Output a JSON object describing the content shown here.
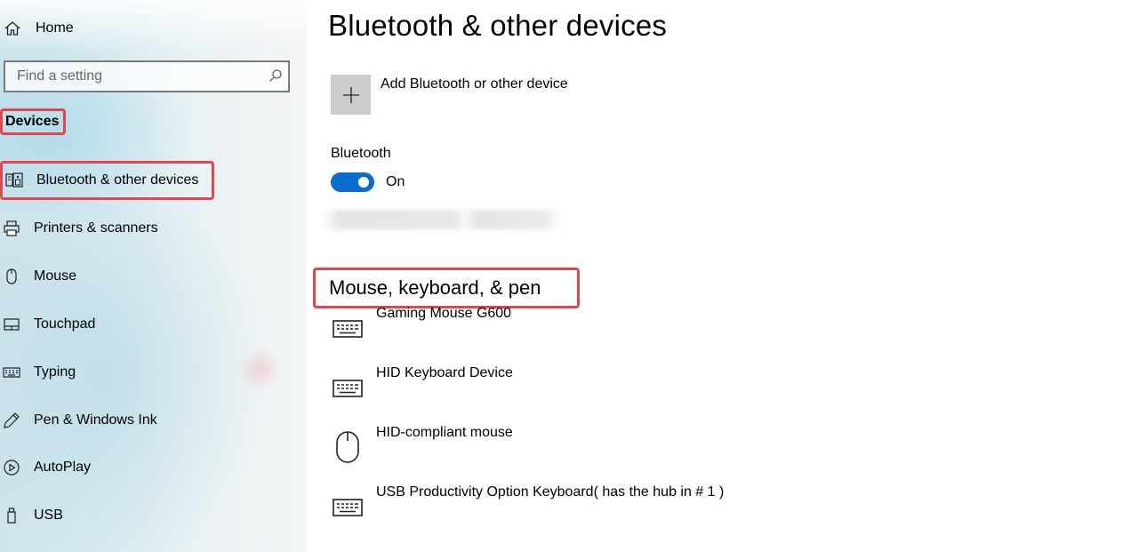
{
  "sidebar": {
    "home": {
      "label": "Home",
      "icon": "home-icon"
    },
    "search": {
      "placeholder": "Find a setting",
      "icon": "search-icon"
    },
    "section_label": "Devices",
    "items": [
      {
        "label": "Bluetooth & other devices",
        "icon": "bluetooth-devices-icon",
        "selected": true
      },
      {
        "label": "Printers & scanners",
        "icon": "printer-icon"
      },
      {
        "label": "Mouse",
        "icon": "mouse-icon"
      },
      {
        "label": "Touchpad",
        "icon": "touchpad-icon"
      },
      {
        "label": "Typing",
        "icon": "keyboard-icon"
      },
      {
        "label": "Pen & Windows Ink",
        "icon": "pen-icon"
      },
      {
        "label": "AutoPlay",
        "icon": "autoplay-icon"
      },
      {
        "label": "USB",
        "icon": "usb-icon"
      }
    ]
  },
  "main": {
    "title": "Bluetooth & other devices",
    "add_device": {
      "label": "Add Bluetooth or other device",
      "icon": "plus-icon"
    },
    "bluetooth": {
      "label": "Bluetooth",
      "state": "On",
      "enabled": true
    },
    "section_heading": "Mouse, keyboard, & pen",
    "devices": [
      {
        "name": "Gaming Mouse G600",
        "icon": "keyboard-icon"
      },
      {
        "name": "HID Keyboard Device",
        "icon": "keyboard-icon"
      },
      {
        "name": "HID-compliant mouse",
        "icon": "mouse-icon"
      },
      {
        "name": "USB Productivity Option Keyboard( has the hub in # 1 )",
        "icon": "keyboard-icon"
      }
    ]
  },
  "colors": {
    "accent": "#0a6ccf",
    "highlight_border": "#e0464f",
    "add_tile": "#cccccc"
  }
}
